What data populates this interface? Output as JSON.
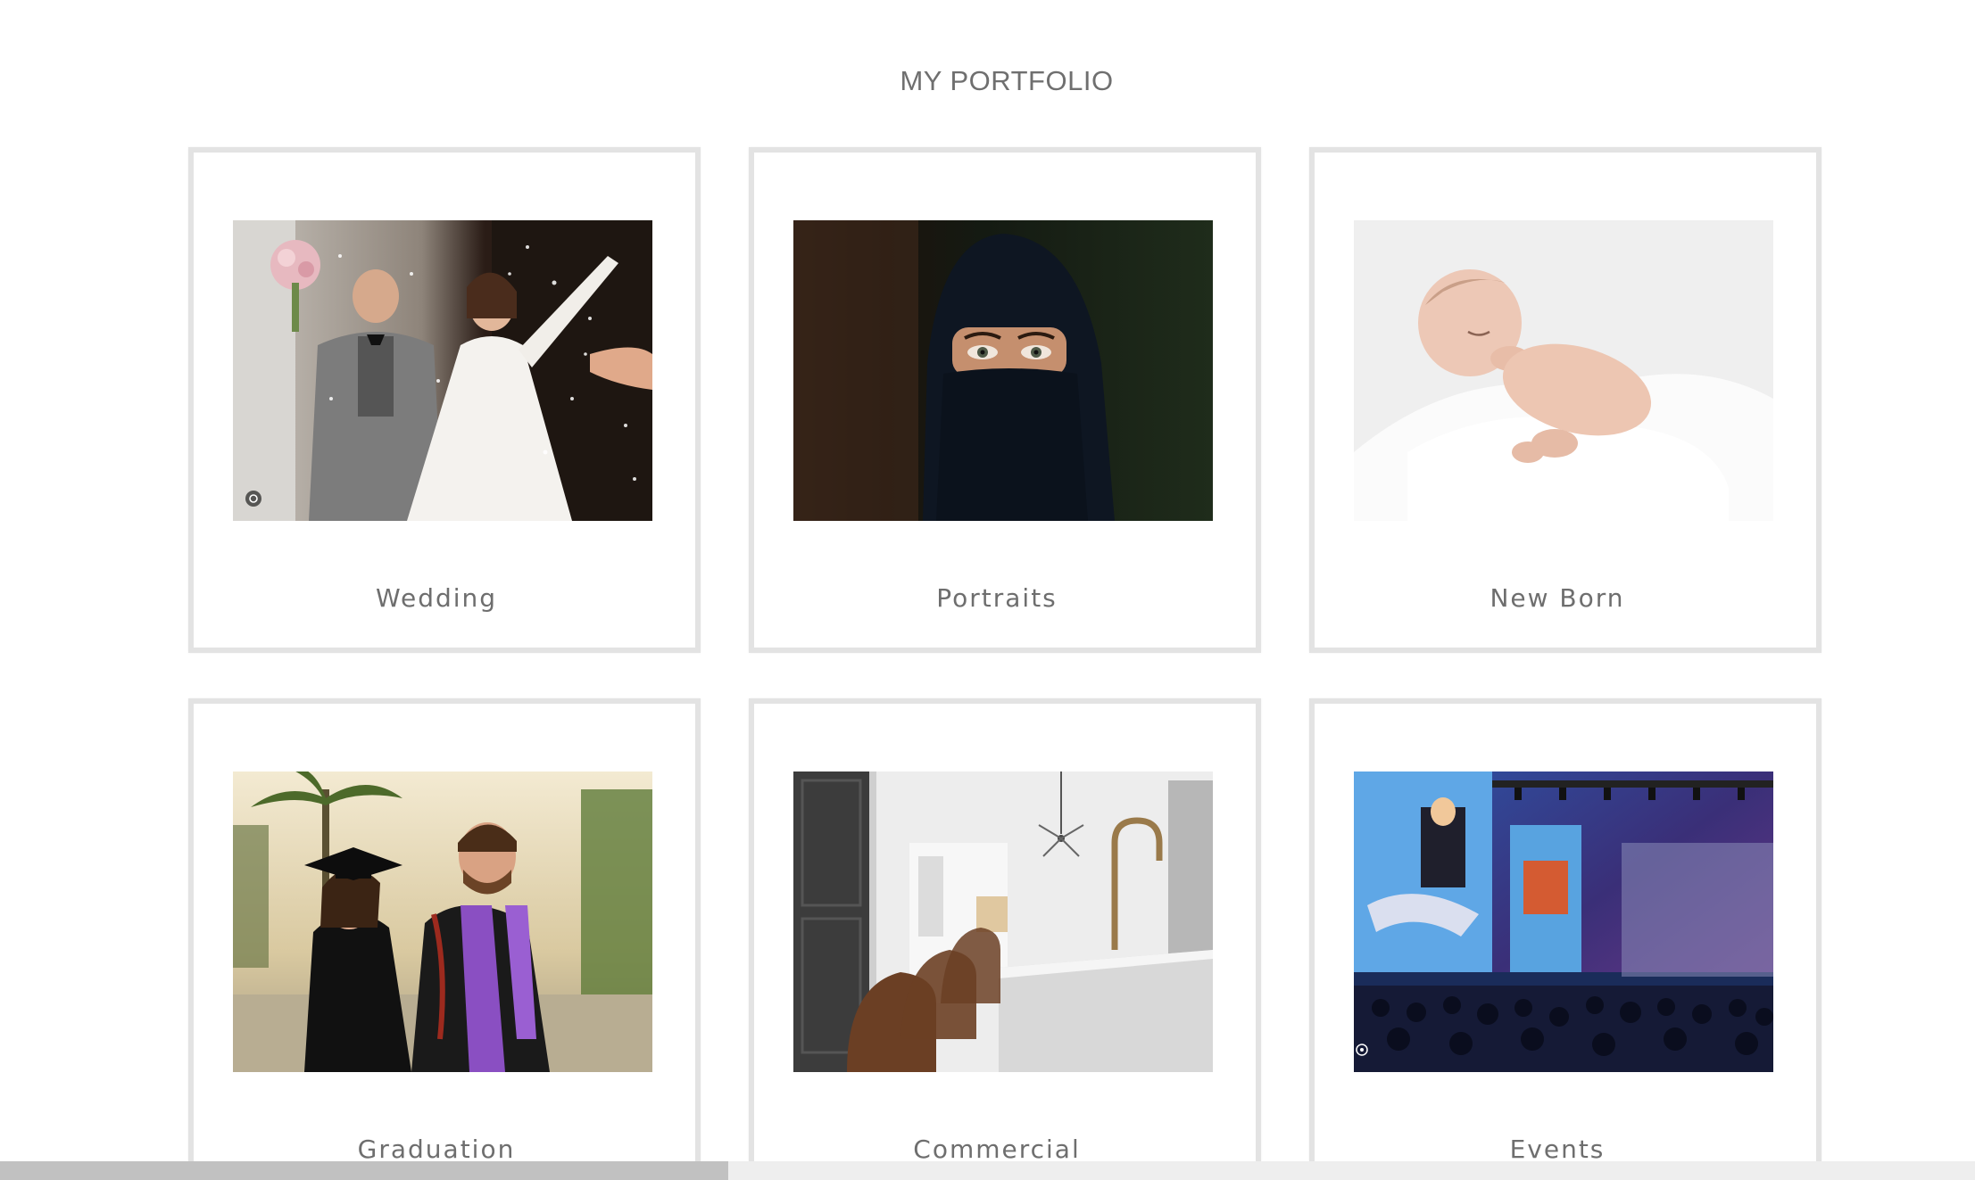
{
  "portfolio": {
    "title": "MY PORTFOLIO",
    "items": [
      {
        "label": "Wedding",
        "image": "wedding-photo"
      },
      {
        "label": "Portraits",
        "image": "portrait-photo"
      },
      {
        "label": "New Born",
        "image": "newborn-photo"
      },
      {
        "label": "Graduation",
        "image": "graduation-photo"
      },
      {
        "label": "Commercial",
        "image": "commercial-photo"
      },
      {
        "label": "Events",
        "image": "events-photo"
      }
    ]
  },
  "colors": {
    "card_border": "#e3e3e3",
    "title_text": "#6f6f6f",
    "label_text": "#6e6e6e"
  }
}
